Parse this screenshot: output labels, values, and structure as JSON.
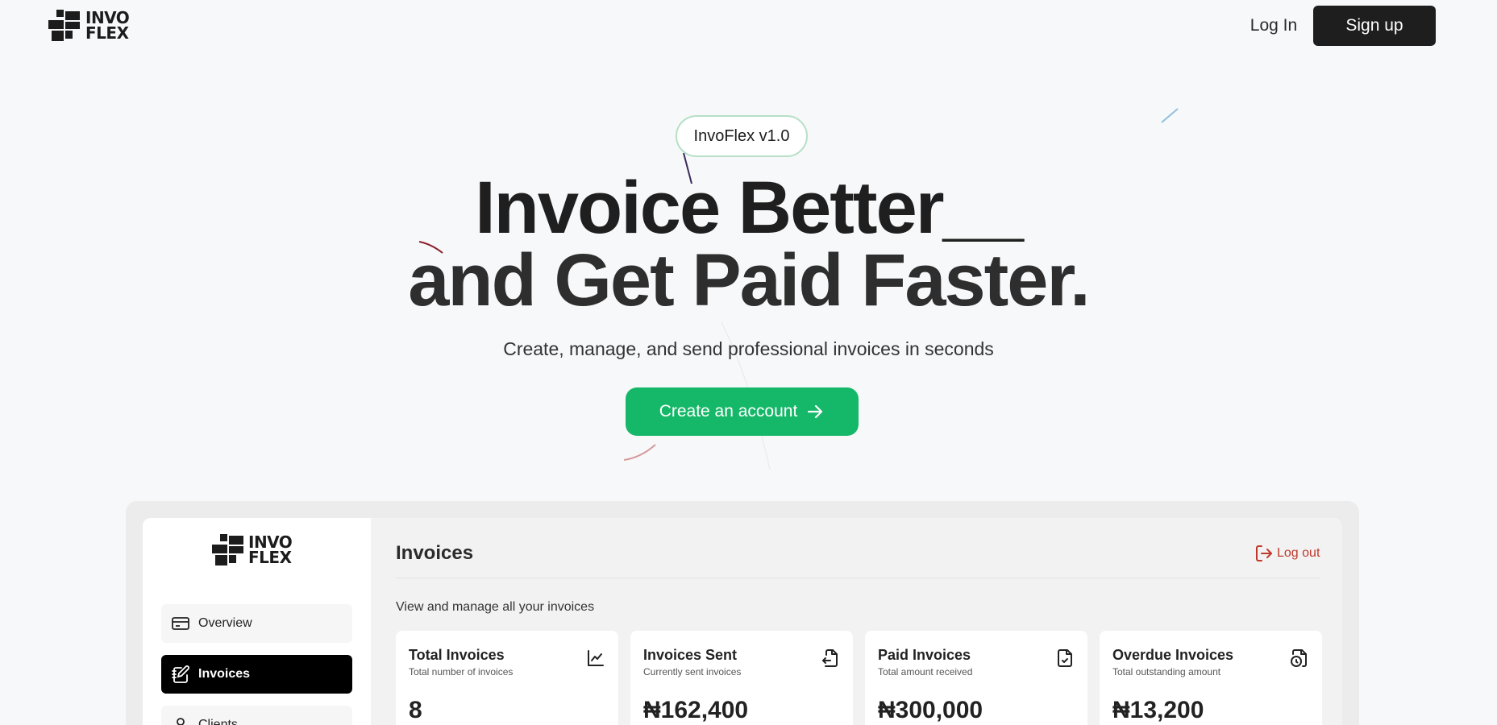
{
  "brand": {
    "line1": "INVO",
    "line2": "FLEX"
  },
  "nav": {
    "login": "Log In",
    "signup": "Sign up"
  },
  "hero": {
    "version": "InvoFlex v1.0",
    "headline_line1": "Invoice Better__",
    "headline_line2": "and Get Paid Faster.",
    "subtitle": "Create, manage, and send professional invoices in seconds",
    "cta": "Create an account",
    "cta_icon": "arrow-right-icon"
  },
  "colors": {
    "accent": "#15b868",
    "dark": "#1e1e1e",
    "logout": "#c0392b"
  },
  "dashboard": {
    "sidebar": {
      "items": [
        {
          "label": "Overview",
          "icon": "credit-card-icon"
        },
        {
          "label": "Invoices",
          "icon": "notebook-pen-icon",
          "active": true
        },
        {
          "label": "Clients",
          "icon": "user-icon"
        }
      ]
    },
    "title": "Invoices",
    "logout": "Log out",
    "subtitle": "View and manage all your invoices",
    "cards": [
      {
        "title": "Total Invoices",
        "desc": "Total number of invoices",
        "value": "8",
        "icon": "line-chart-icon"
      },
      {
        "title": "Invoices Sent",
        "desc": "Currently sent invoices",
        "value": "₦162,400",
        "icon": "file-export-icon"
      },
      {
        "title": "Paid Invoices",
        "desc": "Total amount received",
        "value": "₦300,000",
        "icon": "file-check-icon"
      },
      {
        "title": "Overdue Invoices",
        "desc": "Total outstanding amount",
        "value": "₦13,200",
        "icon": "file-clock-icon"
      }
    ]
  }
}
